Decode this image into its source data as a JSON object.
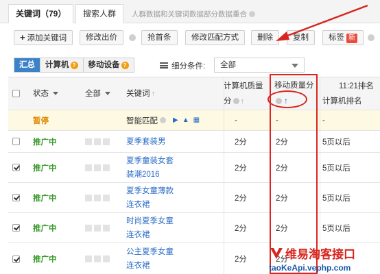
{
  "tabs": {
    "keywords": "关键词（79）",
    "audience": "搜索人群",
    "note": "人群数据和关键词数据部分数据重合"
  },
  "toolbar": {
    "add_keyword": "添加关键词",
    "edit_bid": "修改出价",
    "grab_top": "抢首条",
    "edit_match": "修改匹配方式",
    "delete": "删除",
    "copy": "复制",
    "tag": "标签",
    "tag_badge": "新"
  },
  "filter": {
    "seg_summary": "汇总",
    "seg_computer": "计算机",
    "seg_mobile": "移动设备",
    "condition_label": "细分条件:",
    "condition_value": "全部"
  },
  "table": {
    "headers": {
      "status": "状态",
      "all": "全部",
      "keyword": "关键词",
      "pc_quality_1": "计算机质量",
      "pc_quality_2": "分",
      "mobile_quality_1": "移动质量分",
      "time": "11:21排名",
      "pc_rank": "计算机排名"
    },
    "smart_row": {
      "status": "暂停",
      "keyword": "智能匹配",
      "pc_quality": "-",
      "mobile_quality": "-",
      "pc_rank": "-"
    },
    "rows": [
      {
        "status": "推广中",
        "keyword_1": "夏季套装男",
        "keyword_2": "",
        "pc_quality": "2分",
        "mobile_quality": "2分",
        "pc_rank": "5页以后"
      },
      {
        "status": "推广中",
        "keyword_1": "夏季童装女套",
        "keyword_2": "装潮2016",
        "pc_quality": "2分",
        "mobile_quality": "2分",
        "pc_rank": "5页以后"
      },
      {
        "status": "推广中",
        "keyword_1": "夏季女童薄款",
        "keyword_2": "连衣裙",
        "pc_quality": "2分",
        "mobile_quality": "2分",
        "pc_rank": "5页以后"
      },
      {
        "status": "推广中",
        "keyword_1": "时尚夏季女童",
        "keyword_2": "连衣裙",
        "pc_quality": "2分",
        "mobile_quality": "2分",
        "pc_rank": "5页以后"
      },
      {
        "status": "推广中",
        "keyword_1": "公主夏季女童",
        "keyword_2": "连衣裙",
        "pc_quality": "2分",
        "mobile_quality": "2分",
        "pc_rank": "5页以后"
      }
    ]
  },
  "watermark": {
    "cn": "维易淘客接口",
    "en": "taoKeApi.vephp.com"
  },
  "colors": {
    "accent_blue": "#3c82c8",
    "active_green": "#3c9b2e",
    "paused_orange": "#e08a00",
    "highlight_red": "#d8251f"
  }
}
